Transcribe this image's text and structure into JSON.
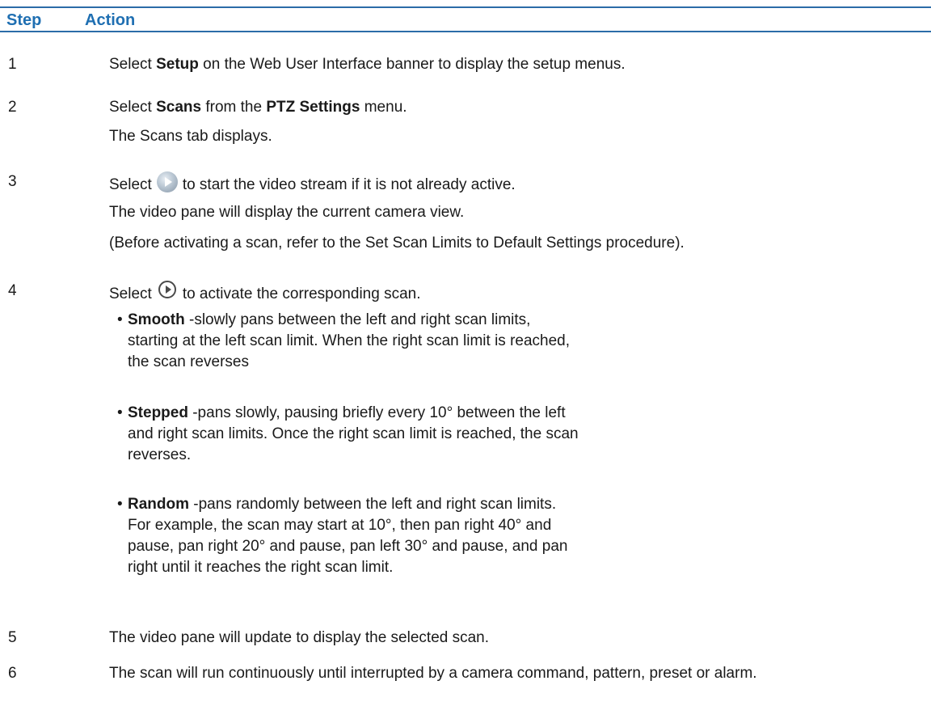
{
  "header": {
    "step": "Step",
    "action": "Action"
  },
  "rows": [
    {
      "num": "1",
      "pre": "Select ",
      "b1": "Setup",
      "post": " on the Web User Interface banner to display the setup menus."
    },
    {
      "num": "2",
      "pre": "Select ",
      "b1": "Scans",
      "mid": " from the ",
      "b2": "PTZ Settings",
      "post": " menu.",
      "note": "The Scans tab displays."
    },
    {
      "num": "3",
      "pre": "Select",
      "icon": "play-stream-icon",
      "post": "to start the video stream if it is not already active.",
      "note1": "The video pane will display the current camera view.",
      "note2": "(Before activating a scan, refer to the Set Scan Limits to Default Settings procedure)."
    },
    {
      "num": "4",
      "pre": "Select",
      "icon": "activate-scan-icon",
      "post": "to activate the corresponding scan.",
      "bullets": [
        {
          "term": "Smooth",
          "text": " -slowly pans between the left and right scan limits, starting at the left scan limit. When the right scan limit is reached, the scan reverses"
        },
        {
          "term": "Stepped",
          "text": " -pans slowly, pausing briefly every 10° between the left and right scan limits. Once the right scan limit is reached, the scan reverses."
        },
        {
          "term": "Random",
          "text": " -pans randomly between the left and right scan limits. For example, the scan may start at 10°, then pan right 40° and pause, pan right 20° and pause, pan left 30° and pause, and pan right until it reaches the right scan limit."
        }
      ]
    },
    {
      "num": "5",
      "text": "The video pane will update to display the selected scan."
    },
    {
      "num": "6",
      "text": "The scan will run continuously until interrupted by a camera command, pattern, preset or alarm."
    }
  ],
  "bullet_char": "•"
}
